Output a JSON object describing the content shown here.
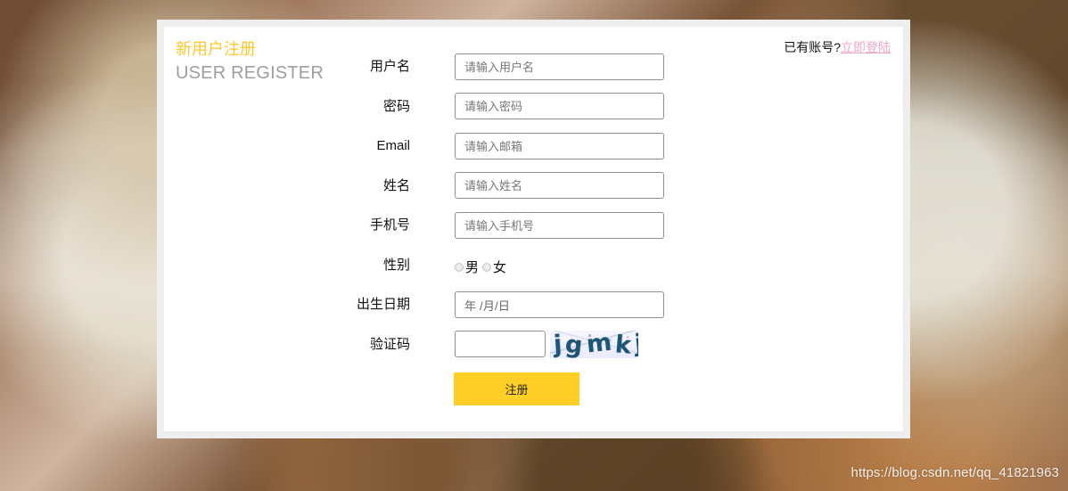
{
  "header": {
    "title_cn": "新用户注册",
    "title_en": "USER REGISTER"
  },
  "login": {
    "prompt": "已有账号?",
    "link_text": "立即登陆"
  },
  "form": {
    "fields": [
      {
        "label": "用户名",
        "placeholder": "请输入用户名",
        "value": ""
      },
      {
        "label": "密码",
        "placeholder": "请输入密码",
        "value": ""
      },
      {
        "label": "Email",
        "placeholder": "请输入邮箱",
        "value": ""
      },
      {
        "label": "姓名",
        "placeholder": "请输入姓名",
        "value": ""
      },
      {
        "label": "手机号",
        "placeholder": "请输入手机号",
        "value": ""
      }
    ],
    "gender": {
      "label": "性别",
      "options": [
        "男",
        "女"
      ]
    },
    "birthdate": {
      "label": "出生日期",
      "display": "年 /月/日"
    },
    "captcha": {
      "label": "验证码",
      "value": "",
      "image_text": "jgmkj"
    },
    "submit_label": "注册"
  },
  "watermark": "https://blog.csdn.net/qq_41821963",
  "colors": {
    "accent": "#ffc62d",
    "submit": "#ffcf27",
    "link": "#f2a6c7",
    "card_border": "#eeeeee",
    "muted_text": "#9e9e9e"
  }
}
